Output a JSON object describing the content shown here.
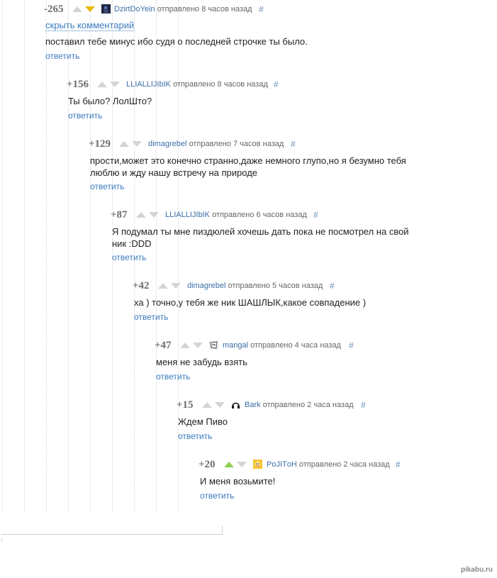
{
  "comments": [
    {
      "rating": "-265",
      "user": "DzirtDoYein",
      "time": "отправлено 8 часов назад",
      "hash": "#",
      "hide": "скрыть комментарий",
      "text": "поставил тебе минус ибо судя о последней строчке ты было.",
      "reply": "ответить",
      "vote": "down",
      "avatar_icon": "dark-avatar-icon"
    },
    {
      "rating": "+156",
      "user": "LLIALLIJIbIK",
      "time": "отправлено 8 часов назад",
      "hash": "#",
      "text": "Ты было? ЛолШто?",
      "reply": "ответить"
    },
    {
      "rating": "+129",
      "user": "dimagrebel",
      "time": "отправлено 7 часов назад",
      "hash": "#",
      "text_line1": "прости,может это конечно странно,даже немного глупо,но я безумно тебя",
      "text_line2": "люблю и жду нашу встречу на природе",
      "reply": "ответить"
    },
    {
      "rating": "+87",
      "user": "LLIALLIJIbIK",
      "time": "отправлено 6 часов назад",
      "hash": "#",
      "text_line1": "Я подумал ты мне пиздюлей хочешь дать пока не посмотрел на свой",
      "text_line2": "ник :DDD",
      "reply": "ответить"
    },
    {
      "rating": "+42",
      "user": "dimagrebel",
      "time": "отправлено 5 часов назад",
      "hash": "#",
      "text": "ха ) точно,у тебя же ник ШАШЛЫК,какое совпадение )",
      "reply": "ответить"
    },
    {
      "rating": "+47",
      "user": "mangal",
      "time": "отправлено 4 часа назад",
      "hash": "#",
      "text": "меня не забудь взять",
      "reply": "ответить",
      "avatar_icon": "sketch-avatar-icon"
    },
    {
      "rating": "+15",
      "user": "Bark",
      "time": "отправлено 2 часа назад",
      "hash": "#",
      "text": "Ждем Пиво",
      "reply": "ответить",
      "avatar_icon": "headphones-avatar-icon"
    },
    {
      "rating": "+20",
      "user": "PoJITоH",
      "time": "отправлено 2 часа назад",
      "hash": "#",
      "text": "И меня возьмите!",
      "reply": "ответить",
      "vote": "up",
      "avatar_icon": "cartoon-avatar-icon"
    }
  ],
  "watermark": "pikabu.ru",
  "colors": {
    "link": "#3b7bbf",
    "user": "#3a6fa8",
    "upvote": "#8fd14f",
    "downvote": "#e8b800",
    "arrow": "#d4d4d4"
  }
}
